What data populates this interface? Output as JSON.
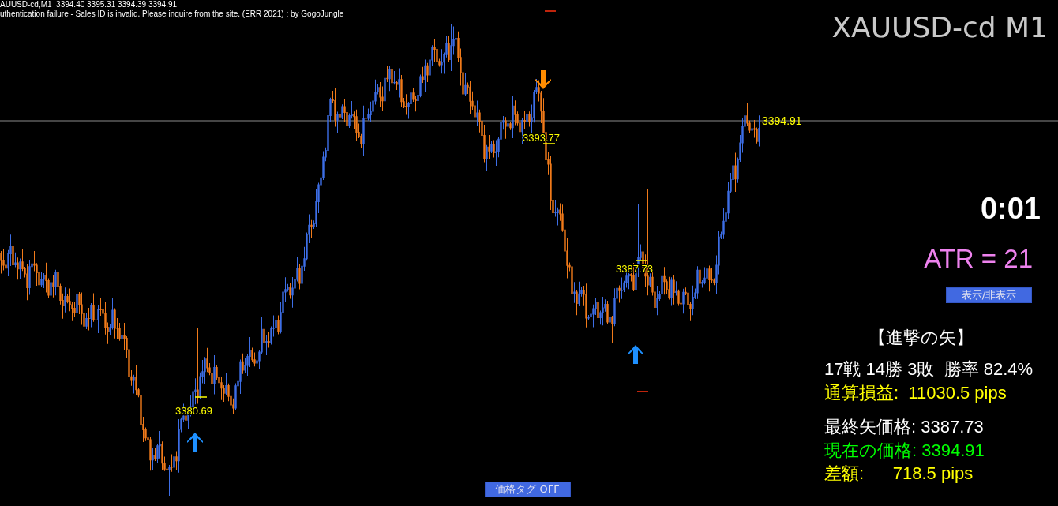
{
  "chart_header": {
    "symbol_line": "AUUSD-cd,M1  3394.40 3395.31 3394.39 3394.91",
    "message": "uthentication failure - Sales ID is invalid. Please inquire from the site. (ERR 2021) : by GogoJungle"
  },
  "symbol_title": "XAUUSD-cd M1",
  "chart": {
    "current_price": "3394.91",
    "price_tags": [
      "3393.77",
      "3387.73",
      "3380.69"
    ],
    "signals": [
      {
        "kind": "down"
      },
      {
        "kind": "up"
      },
      {
        "kind": "up"
      }
    ]
  },
  "timer": "0:01",
  "atr": "ATR = 21",
  "toggle_button": "表示/非表示",
  "stats": {
    "title": "【進撃の矢】",
    "summary": [
      {
        "text": "17戦 14勝 3敗  勝率 82.4%",
        "color": "#ffffff"
      },
      {
        "text": "通算損益:  11030.5 pips",
        "color": "#ffff00"
      }
    ],
    "prices": [
      {
        "text": "最終矢価格: 3387.73",
        "color": "#ffffff"
      },
      {
        "text": "現在の価格: 3394.91",
        "color": "#00ff00"
      },
      {
        "text": "差額:      718.5 pips",
        "color": "#ffff00"
      }
    ]
  },
  "price_tag_button": "価格タグ OFF"
}
